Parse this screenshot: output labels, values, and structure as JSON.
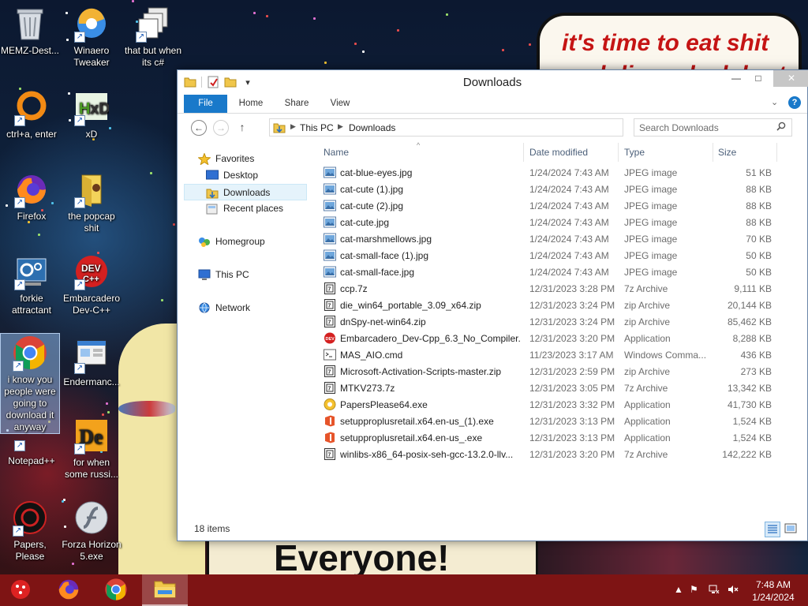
{
  "wallpaper": {
    "meme_line_1": "it's time to eat shit",
    "meme_line_2": "and die andcelebrate",
    "poster_text": "Everyone!"
  },
  "desktop_icons": [
    {
      "label": "MEMZ-Dest...",
      "icon": "recycle-bin-icon"
    },
    {
      "label": "Winaero Tweaker",
      "icon": "winaero-tweaker-icon"
    },
    {
      "label": "that but when its c#",
      "icon": "copy-stack-icon"
    },
    {
      "label": "ctrl+a, enter",
      "icon": "orange-ring-icon"
    },
    {
      "label": "xD",
      "icon": "hxd-icon"
    },
    {
      "label": "Firefox",
      "icon": "firefox-icon"
    },
    {
      "label": "the popcap shit",
      "icon": "popcap-icon"
    },
    {
      "label": "forkie attractant",
      "icon": "settings-tool-icon"
    },
    {
      "label": "Embarcadero Dev-C++",
      "icon": "devcpp-icon"
    },
    {
      "label": "i know you people were going to download it anyway",
      "icon": "chrome-icon"
    },
    {
      "label": "Endermanc...",
      "icon": "window-app-icon"
    },
    {
      "label": "Notepad++",
      "icon": "notepadpp-icon"
    },
    {
      "label": "for when some russi...",
      "icon": "de-app-icon"
    },
    {
      "label": "Papers, Please",
      "icon": "papers-please-icon"
    },
    {
      "label": "Forza Horizon 5.exe",
      "icon": "flash-icon"
    }
  ],
  "window": {
    "title": "Downloads",
    "buttons": {
      "minimize": "—",
      "maximize": "□",
      "close": "✕"
    },
    "ribbon_tabs": [
      "File",
      "Home",
      "Share",
      "View"
    ],
    "address": {
      "crumbs": [
        "This PC",
        "Downloads"
      ],
      "separator": "▶"
    },
    "search_placeholder": "Search Downloads",
    "nav_pane": [
      {
        "label": "Favorites",
        "icon": "star-icon"
      },
      {
        "label": "Desktop",
        "icon": "desktop-icon"
      },
      {
        "label": "Downloads",
        "icon": "downloads-folder-icon"
      },
      {
        "label": "Recent places",
        "icon": "recent-places-icon"
      },
      {
        "label": "Homegroup",
        "icon": "homegroup-icon"
      },
      {
        "label": "This PC",
        "icon": "this-pc-icon"
      },
      {
        "label": "Network",
        "icon": "network-icon"
      }
    ],
    "columns": [
      "Name",
      "Date modified",
      "Type",
      "Size"
    ],
    "files": [
      {
        "name": "cat-blue-eyes.jpg",
        "date": "1/24/2024 7:43 AM",
        "type": "JPEG image",
        "size": "51 KB",
        "icon": "jpeg-icon"
      },
      {
        "name": "cat-cute (1).jpg",
        "date": "1/24/2024 7:43 AM",
        "type": "JPEG image",
        "size": "88 KB",
        "icon": "jpeg-icon"
      },
      {
        "name": "cat-cute (2).jpg",
        "date": "1/24/2024 7:43 AM",
        "type": "JPEG image",
        "size": "88 KB",
        "icon": "jpeg-icon"
      },
      {
        "name": "cat-cute.jpg",
        "date": "1/24/2024 7:43 AM",
        "type": "JPEG image",
        "size": "88 KB",
        "icon": "jpeg-icon"
      },
      {
        "name": "cat-marshmellows.jpg",
        "date": "1/24/2024 7:43 AM",
        "type": "JPEG image",
        "size": "70 KB",
        "icon": "jpeg-icon"
      },
      {
        "name": "cat-small-face (1).jpg",
        "date": "1/24/2024 7:43 AM",
        "type": "JPEG image",
        "size": "50 KB",
        "icon": "jpeg-icon"
      },
      {
        "name": "cat-small-face.jpg",
        "date": "1/24/2024 7:43 AM",
        "type": "JPEG image",
        "size": "50 KB",
        "icon": "jpeg-icon"
      },
      {
        "name": "ccp.7z",
        "date": "12/31/2023 3:28 PM",
        "type": "7z Archive",
        "size": "9,111 KB",
        "icon": "archive-icon"
      },
      {
        "name": "die_win64_portable_3.09_x64.zip",
        "date": "12/31/2023 3:24 PM",
        "type": "zip Archive",
        "size": "20,144 KB",
        "icon": "archive-icon"
      },
      {
        "name": "dnSpy-net-win64.zip",
        "date": "12/31/2023 3:24 PM",
        "type": "zip Archive",
        "size": "85,462 KB",
        "icon": "archive-icon"
      },
      {
        "name": "Embarcadero_Dev-Cpp_6.3_No_Compiler...",
        "date": "12/31/2023 3:20 PM",
        "type": "Application",
        "size": "8,288 KB",
        "icon": "devcpp-app-icon"
      },
      {
        "name": "MAS_AIO.cmd",
        "date": "11/23/2023 3:17 AM",
        "type": "Windows Comma...",
        "size": "436 KB",
        "icon": "cmd-icon"
      },
      {
        "name": "Microsoft-Activation-Scripts-master.zip",
        "date": "12/31/2023 2:59 PM",
        "type": "zip Archive",
        "size": "273 KB",
        "icon": "archive-icon"
      },
      {
        "name": "MTKV273.7z",
        "date": "12/31/2023 3:05 PM",
        "type": "7z Archive",
        "size": "13,342 KB",
        "icon": "archive-icon"
      },
      {
        "name": "PapersPlease64.exe",
        "date": "12/31/2023 3:32 PM",
        "type": "Application",
        "size": "41,730 KB",
        "icon": "papers-please-app-icon"
      },
      {
        "name": "setupproplusretail.x64.en-us_(1).exe",
        "date": "12/31/2023 3:13 PM",
        "type": "Application",
        "size": "1,524 KB",
        "icon": "office-icon"
      },
      {
        "name": "setupproplusretail.x64.en-us_.exe",
        "date": "12/31/2023 3:13 PM",
        "type": "Application",
        "size": "1,524 KB",
        "icon": "office-icon"
      },
      {
        "name": "winlibs-x86_64-posix-seh-gcc-13.2.0-llv...",
        "date": "12/31/2023 3:20 PM",
        "type": "7z Archive",
        "size": "142,222 KB",
        "icon": "archive-icon"
      }
    ],
    "status": {
      "item_count": "18 items"
    }
  },
  "taskbar": {
    "apps": [
      "start-orb-icon",
      "firefox-icon",
      "chrome-icon",
      "file-explorer-icon"
    ],
    "clock": {
      "time": "7:48 AM",
      "date": "1/24/2024"
    }
  }
}
